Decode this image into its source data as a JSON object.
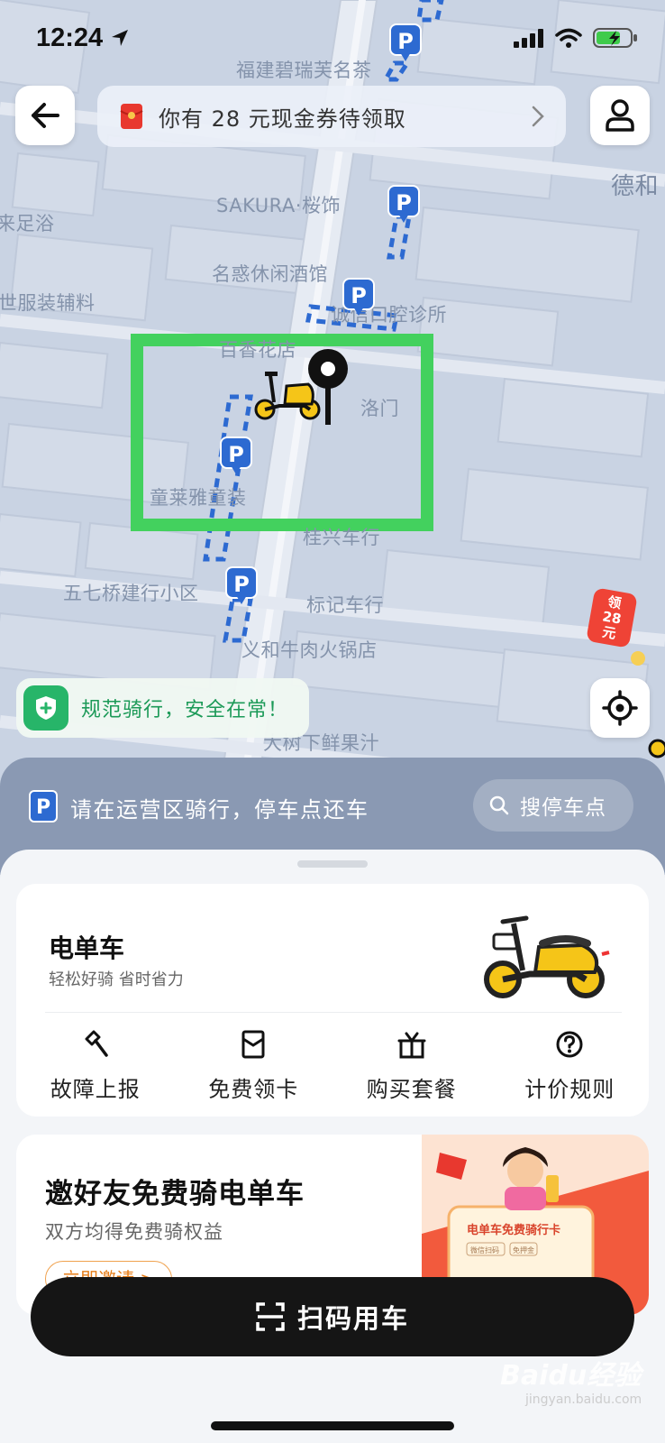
{
  "status_bar": {
    "time": "12:24"
  },
  "coupon_bar": {
    "text": "你有 28 元现金券待领取"
  },
  "map": {
    "labels": {
      "fujian": "福建碧瑞芙名茶",
      "sakura": "SAKURA·桜饰",
      "dehe": "德和",
      "zuyu": "来足浴",
      "mingduo": "名惑休闲酒馆",
      "fuzhuang": "世服装辅料",
      "kouqiang": "诚信口腔诊所",
      "luomen": "洛门",
      "tonglai": "童莱雅童装",
      "wuqiqiao": "五七桥建行小区",
      "biaoji": "标记车行",
      "yihe": "义和牛肉火锅店",
      "dashu": "大树下鲜果汁",
      "chexing": "桂兴车行",
      "jiuba": "百香花店"
    },
    "highlight_color": "#43d15e",
    "parking_color": "#2d6ad1"
  },
  "safety_banner": {
    "text": "规范骑行，安全在常！"
  },
  "red_badge": {
    "line1": "领",
    "line2": "28",
    "line3": "元"
  },
  "notice": {
    "p_label": "P",
    "text": "请在运营区骑行，停车点还车",
    "search_label": "搜停车点"
  },
  "ebike_card": {
    "title": "电单车",
    "subtitle": "轻松好骑 省时省力",
    "actions": [
      {
        "label": "故障上报",
        "icon": "hammer-icon"
      },
      {
        "label": "免费领卡",
        "icon": "card-icon"
      },
      {
        "label": "购买套餐",
        "icon": "gift-icon"
      },
      {
        "label": "计价规则",
        "icon": "question-icon"
      }
    ]
  },
  "invite_card": {
    "title": "邀好友免费骑电单车",
    "subtitle": "双方均得免费骑权益",
    "button": "立即邀请 >",
    "promo_card_title": "电单车免费骑行卡",
    "promo_tag1": "微信扫码",
    "promo_tag2": "免押金"
  },
  "scan_button": {
    "label": "扫码用车"
  },
  "watermark": {
    "brand": "Baidu经验",
    "site": "jingyan.baidu.com"
  }
}
